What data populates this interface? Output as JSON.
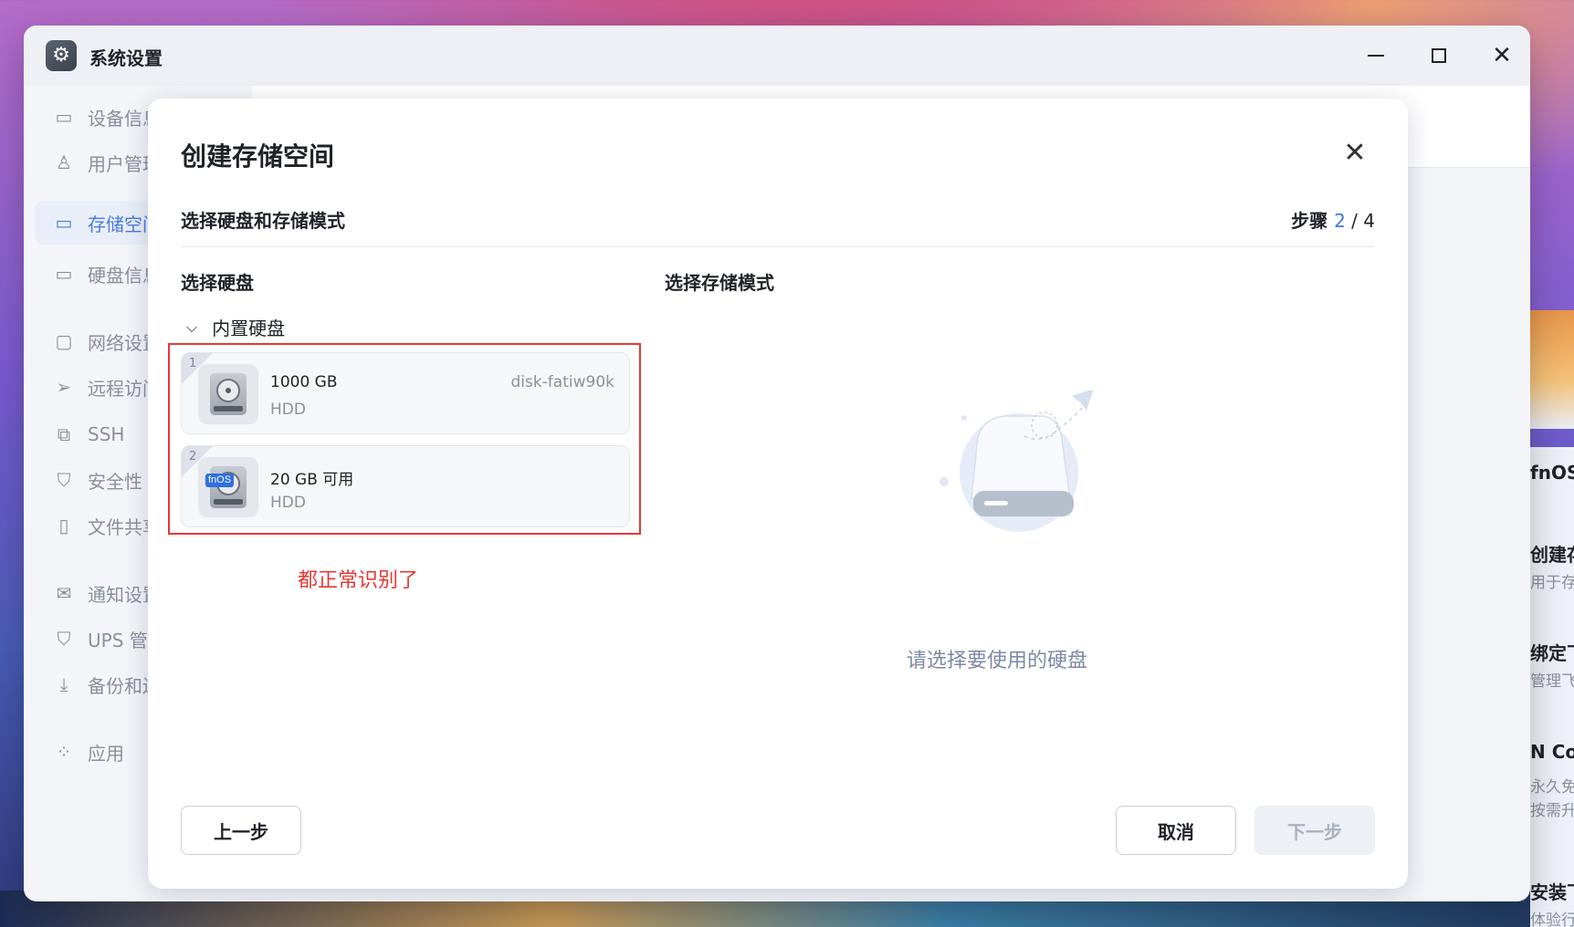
{
  "window": {
    "title": "系统设置"
  },
  "sidebar": {
    "items": [
      {
        "label": "设备信息",
        "icon": "drive-icon"
      },
      {
        "label": "用户管理",
        "icon": "user-icon"
      },
      {
        "label": "存储空间",
        "icon": "storage-icon",
        "active": true
      },
      {
        "label": "硬盘信息",
        "icon": "disk-icon"
      },
      {
        "label": "网络设置",
        "icon": "network-icon"
      },
      {
        "label": "远程访问",
        "icon": "send-icon"
      },
      {
        "label": "SSH",
        "icon": "code-icon"
      },
      {
        "label": "安全性",
        "icon": "shield-icon"
      },
      {
        "label": "文件共享",
        "icon": "file-icon"
      },
      {
        "label": "通知设置",
        "icon": "mail-icon"
      },
      {
        "label": "UPS 管理",
        "icon": "shield-outline-icon"
      },
      {
        "label": "备份和还原",
        "icon": "download-icon"
      },
      {
        "label": "应用",
        "icon": "apps-icon"
      }
    ]
  },
  "right_panel": {
    "items": [
      {
        "title": "fnOS",
        "sub": ""
      },
      {
        "title": "创建存储",
        "sub": "用于存储"
      },
      {
        "title": "绑定飞",
        "sub": "管理飞牛"
      },
      {
        "title": "N Con",
        "sub": "永久免费"
      },
      {
        "title": "",
        "sub": "按需升级"
      },
      {
        "title": "安装飞",
        "sub": "体验行"
      }
    ]
  },
  "modal": {
    "title": "创建存储空间",
    "section_title": "选择硬盘和存储模式",
    "step_label": "步骤",
    "step_current": "2",
    "step_sep": " / ",
    "step_total": "4",
    "left_col_title": "选择硬盘",
    "right_col_title": "选择存储模式",
    "group_label": "内置硬盘",
    "disks": [
      {
        "index": "1",
        "size": "1000 GB",
        "type": "HDD",
        "name": "disk-fatiw90k",
        "badge": ""
      },
      {
        "index": "2",
        "size": "20 GB 可用",
        "type": "HDD",
        "name": "",
        "badge": "fnOS"
      }
    ],
    "annotation": "都正常识别了",
    "empty_text": "请选择要使用的硬盘",
    "buttons": {
      "prev": "上一步",
      "cancel": "取消",
      "next": "下一步"
    }
  },
  "colors": {
    "accent": "#3a7ae0",
    "annotation": "#e53935"
  }
}
